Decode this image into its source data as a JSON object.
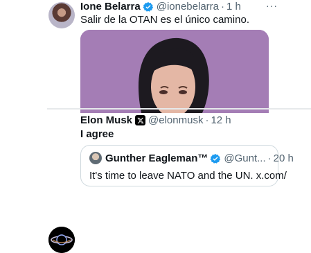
{
  "tweets": [
    {
      "author_name": "Ione Belarra",
      "handle": "@ionebelarra",
      "separator": "·",
      "time": "1 h",
      "text": "Salir de la OTAN es el único camino.",
      "more": "···"
    },
    {
      "author_name": "Elon Musk",
      "handle": "@elonmusk",
      "separator": "·",
      "time": "12 h",
      "text": "I agree",
      "quote": {
        "author_name": "Gunther Eagleman™",
        "handle": "@Gunt...",
        "separator": "·",
        "time": "20 h",
        "text": "It's time to leave NATO and the UN. x.com/"
      }
    }
  ],
  "colors": {
    "verified_blue": "#1d9bf0",
    "media_background": "#a47db5"
  }
}
